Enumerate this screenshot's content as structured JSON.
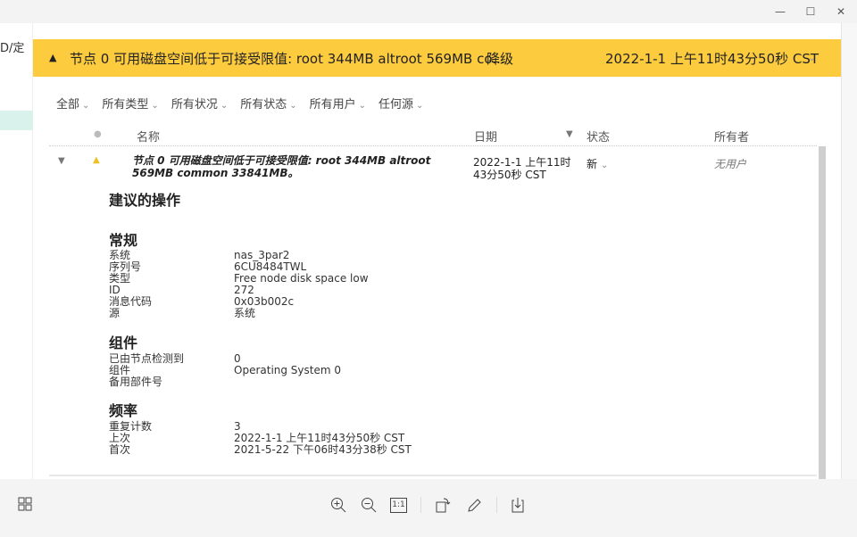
{
  "window": {
    "minimize": "—",
    "maximize": "☐",
    "close": "✕"
  },
  "left_panel": {
    "partial_text": "D/定"
  },
  "banner": {
    "icon": "warning-triangle-icon",
    "message": "节点 0 可用磁盘空间低于可接受限值: root 344MB altroot 569MB co...",
    "severity": "降级",
    "date": "2022-1-1 上午11时43分50秒 CST",
    "color": "#fdcb3e"
  },
  "filters": [
    {
      "label": "全部"
    },
    {
      "label": "所有类型"
    },
    {
      "label": "所有状况"
    },
    {
      "label": "所有状态"
    },
    {
      "label": "所有用户"
    },
    {
      "label": "任何源"
    }
  ],
  "columns": {
    "name": "名称",
    "date": "日期",
    "status": "状态",
    "owner": "所有者"
  },
  "row": {
    "name": "节点 0 可用磁盘空间低于可接受限值: root 344MB altroot 569MB common 33841MB。",
    "date": "2022-1-1 上午11时43分50秒 CST",
    "status": "新",
    "owner": "无用户"
  },
  "details": {
    "actions_heading": "建议的操作",
    "general_heading": "常规",
    "general": [
      {
        "k": "系统",
        "v": "nas_3par2"
      },
      {
        "k": "序列号",
        "v": "6CU8484TWL"
      },
      {
        "k": "类型",
        "v": "Free node disk space low"
      },
      {
        "k": "ID",
        "v": "272"
      },
      {
        "k": "消息代码",
        "v": "0x03b002c"
      },
      {
        "k": "源",
        "v": "系统"
      }
    ],
    "component_heading": "组件",
    "component": [
      {
        "k": "已由节点检测到",
        "v": "0"
      },
      {
        "k": "组件",
        "v": "Operating System 0"
      },
      {
        "k": "备用部件号",
        "v": ""
      }
    ],
    "frequency_heading": "频率",
    "frequency": [
      {
        "k": "重复计数",
        "v": "3"
      },
      {
        "k": "上次",
        "v": "2022-1-1 上午11时43分50秒 CST"
      },
      {
        "k": "首次",
        "v": "2021-5-22 下午06时43分38秒 CST"
      }
    ]
  },
  "toolbar": {
    "actual_size": "1:1"
  }
}
